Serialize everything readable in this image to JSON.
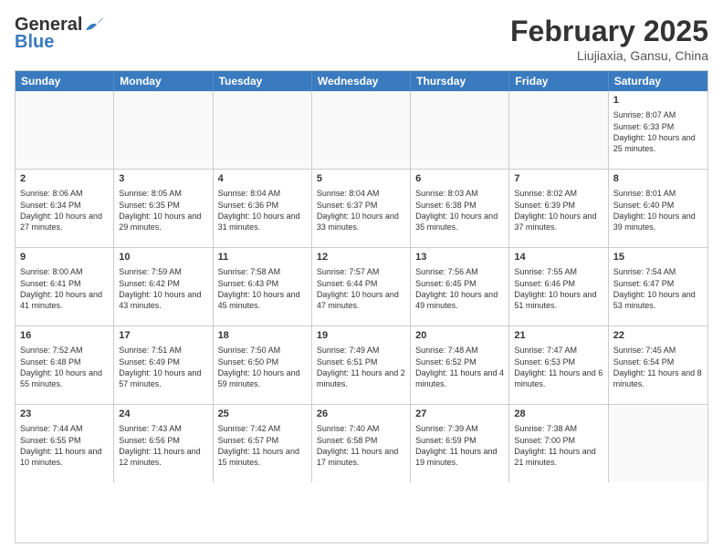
{
  "header": {
    "logo_general": "General",
    "logo_blue": "Blue",
    "month_title": "February 2025",
    "location": "Liujiaxia, Gansu, China"
  },
  "days_of_week": [
    "Sunday",
    "Monday",
    "Tuesday",
    "Wednesday",
    "Thursday",
    "Friday",
    "Saturday"
  ],
  "weeks": [
    [
      {
        "day": "",
        "info": ""
      },
      {
        "day": "",
        "info": ""
      },
      {
        "day": "",
        "info": ""
      },
      {
        "day": "",
        "info": ""
      },
      {
        "day": "",
        "info": ""
      },
      {
        "day": "",
        "info": ""
      },
      {
        "day": "1",
        "info": "Sunrise: 8:07 AM\nSunset: 6:33 PM\nDaylight: 10 hours and 25 minutes."
      }
    ],
    [
      {
        "day": "2",
        "info": "Sunrise: 8:06 AM\nSunset: 6:34 PM\nDaylight: 10 hours and 27 minutes."
      },
      {
        "day": "3",
        "info": "Sunrise: 8:05 AM\nSunset: 6:35 PM\nDaylight: 10 hours and 29 minutes."
      },
      {
        "day": "4",
        "info": "Sunrise: 8:04 AM\nSunset: 6:36 PM\nDaylight: 10 hours and 31 minutes."
      },
      {
        "day": "5",
        "info": "Sunrise: 8:04 AM\nSunset: 6:37 PM\nDaylight: 10 hours and 33 minutes."
      },
      {
        "day": "6",
        "info": "Sunrise: 8:03 AM\nSunset: 6:38 PM\nDaylight: 10 hours and 35 minutes."
      },
      {
        "day": "7",
        "info": "Sunrise: 8:02 AM\nSunset: 6:39 PM\nDaylight: 10 hours and 37 minutes."
      },
      {
        "day": "8",
        "info": "Sunrise: 8:01 AM\nSunset: 6:40 PM\nDaylight: 10 hours and 39 minutes."
      }
    ],
    [
      {
        "day": "9",
        "info": "Sunrise: 8:00 AM\nSunset: 6:41 PM\nDaylight: 10 hours and 41 minutes."
      },
      {
        "day": "10",
        "info": "Sunrise: 7:59 AM\nSunset: 6:42 PM\nDaylight: 10 hours and 43 minutes."
      },
      {
        "day": "11",
        "info": "Sunrise: 7:58 AM\nSunset: 6:43 PM\nDaylight: 10 hours and 45 minutes."
      },
      {
        "day": "12",
        "info": "Sunrise: 7:57 AM\nSunset: 6:44 PM\nDaylight: 10 hours and 47 minutes."
      },
      {
        "day": "13",
        "info": "Sunrise: 7:56 AM\nSunset: 6:45 PM\nDaylight: 10 hours and 49 minutes."
      },
      {
        "day": "14",
        "info": "Sunrise: 7:55 AM\nSunset: 6:46 PM\nDaylight: 10 hours and 51 minutes."
      },
      {
        "day": "15",
        "info": "Sunrise: 7:54 AM\nSunset: 6:47 PM\nDaylight: 10 hours and 53 minutes."
      }
    ],
    [
      {
        "day": "16",
        "info": "Sunrise: 7:52 AM\nSunset: 6:48 PM\nDaylight: 10 hours and 55 minutes."
      },
      {
        "day": "17",
        "info": "Sunrise: 7:51 AM\nSunset: 6:49 PM\nDaylight: 10 hours and 57 minutes."
      },
      {
        "day": "18",
        "info": "Sunrise: 7:50 AM\nSunset: 6:50 PM\nDaylight: 10 hours and 59 minutes."
      },
      {
        "day": "19",
        "info": "Sunrise: 7:49 AM\nSunset: 6:51 PM\nDaylight: 11 hours and 2 minutes."
      },
      {
        "day": "20",
        "info": "Sunrise: 7:48 AM\nSunset: 6:52 PM\nDaylight: 11 hours and 4 minutes."
      },
      {
        "day": "21",
        "info": "Sunrise: 7:47 AM\nSunset: 6:53 PM\nDaylight: 11 hours and 6 minutes."
      },
      {
        "day": "22",
        "info": "Sunrise: 7:45 AM\nSunset: 6:54 PM\nDaylight: 11 hours and 8 minutes."
      }
    ],
    [
      {
        "day": "23",
        "info": "Sunrise: 7:44 AM\nSunset: 6:55 PM\nDaylight: 11 hours and 10 minutes."
      },
      {
        "day": "24",
        "info": "Sunrise: 7:43 AM\nSunset: 6:56 PM\nDaylight: 11 hours and 12 minutes."
      },
      {
        "day": "25",
        "info": "Sunrise: 7:42 AM\nSunset: 6:57 PM\nDaylight: 11 hours and 15 minutes."
      },
      {
        "day": "26",
        "info": "Sunrise: 7:40 AM\nSunset: 6:58 PM\nDaylight: 11 hours and 17 minutes."
      },
      {
        "day": "27",
        "info": "Sunrise: 7:39 AM\nSunset: 6:59 PM\nDaylight: 11 hours and 19 minutes."
      },
      {
        "day": "28",
        "info": "Sunrise: 7:38 AM\nSunset: 7:00 PM\nDaylight: 11 hours and 21 minutes."
      },
      {
        "day": "",
        "info": ""
      }
    ]
  ]
}
